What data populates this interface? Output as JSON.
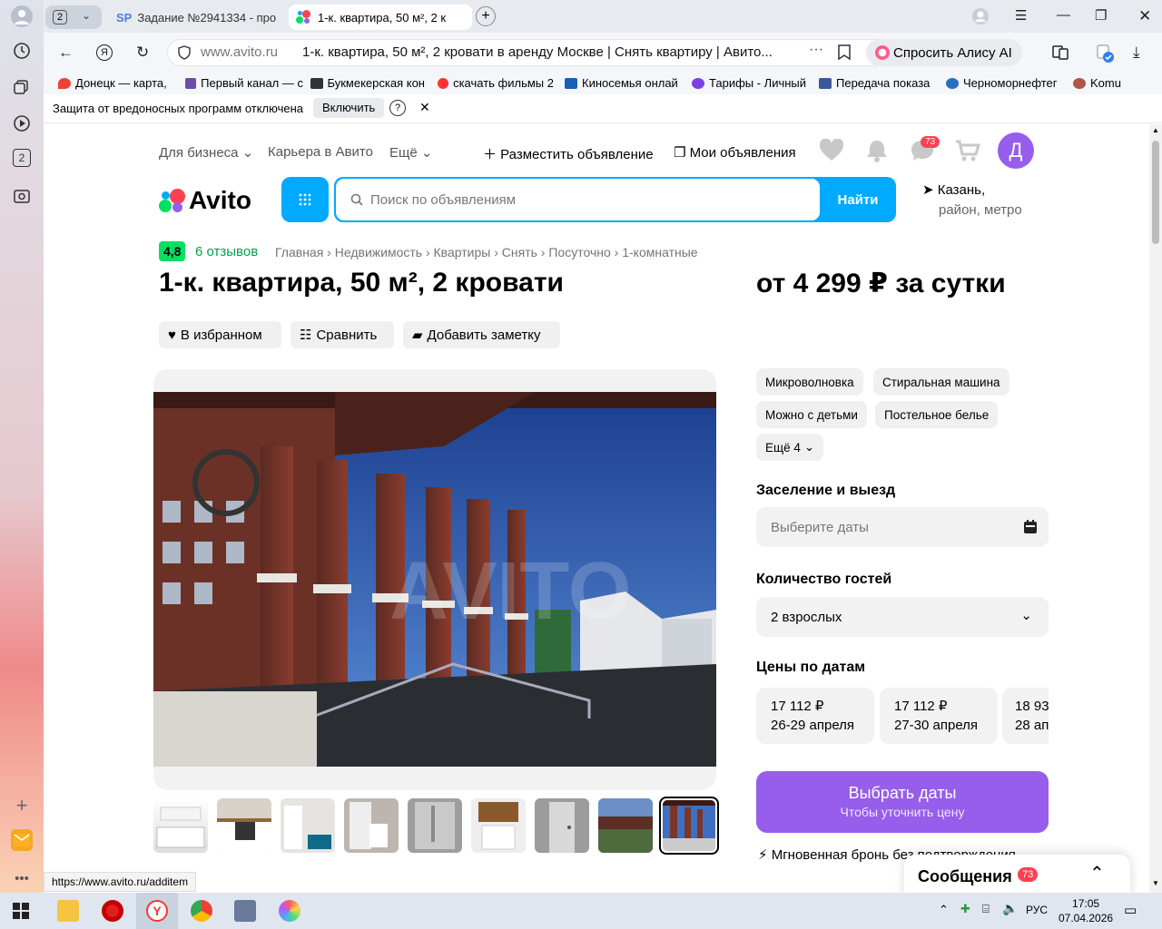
{
  "browser": {
    "tab_group_count": "2",
    "tabs": [
      {
        "favicon": "SP",
        "title": "Задание №2941334 - про"
      },
      {
        "title": "1-к. квартира, 50 м², 2 к"
      }
    ],
    "url_domain": "www.avito.ru",
    "page_title": "1-к. квартира, 50 м², 2 кровати в аренду Москве | Снять квартиру | Авито...",
    "alice_label": "Спросить Алису AI",
    "bookmarks": [
      "Донецк — карта, ",
      "Первый канал — с",
      "Букмекерская кон",
      "скачать фильмы 2",
      "Киносемья онлай",
      "Тарифы - Личный",
      "Передача показа",
      "Черноморнефтег",
      "Komu"
    ],
    "protection_text": "Защита от вредоносных программ отключена",
    "protection_btn": "Включить",
    "protection_help": "?",
    "status_url": "https://www.avito.ru/additem"
  },
  "site": {
    "nav": {
      "business": "Для бизнеса",
      "career": "Карьера в Авито",
      "more": "Ещё",
      "post_ad": "Разместить объявление",
      "my_ads": "Мои объявления",
      "messages_badge": "73",
      "avatar_letter": "Д"
    },
    "logo": "Avito",
    "search_placeholder": "Поиск по объявлениям",
    "search_button": "Найти",
    "location_line1": "Казань,",
    "location_line2": "район, метро"
  },
  "listing": {
    "rating": "4,8",
    "reviews": "6 отзывов",
    "breadcrumbs": [
      "Главная",
      "Недвижимость",
      "Квартиры",
      "Снять",
      "Посуточно",
      "1-комнатные"
    ],
    "title": "1-к. квартира, 50 м², 2 кровати",
    "price": "от 4 299 ₽ за сутки",
    "actions": {
      "favorite": "В избранном",
      "compare": "Сравнить",
      "note": "Добавить заметку"
    },
    "amenities": [
      "Микроволновка",
      "Стиральная машина",
      "Можно с детьми",
      "Постельное белье"
    ],
    "amenities_more": "Ещё 4",
    "checkin_label": "Заселение и выезд",
    "dates_placeholder": "Выберите даты",
    "guests_label": "Количество гостей",
    "guests_value": "2 взрослых",
    "prices_label": "Цены по датам",
    "date_prices": [
      {
        "price": "17 112 ₽",
        "dates": "26-29 апреля"
      },
      {
        "price": "17 112 ₽",
        "dates": "27-30 апреля"
      },
      {
        "price": "18 93",
        "dates": "28 ап"
      }
    ],
    "cta_title": "Выбрать даты",
    "cta_sub": "Чтобы уточнить цену",
    "instant": "Мгновенная бронь без подтверждения",
    "watermark": "AVITO"
  },
  "messages_panel": {
    "label": "Сообщения",
    "badge": "73"
  },
  "taskbar": {
    "lang": "РУС",
    "time": "17:05",
    "date": "07.04.2026"
  },
  "colors": {
    "accent": "#00aaff",
    "purple": "#965eeb",
    "rating": "#04e061"
  }
}
